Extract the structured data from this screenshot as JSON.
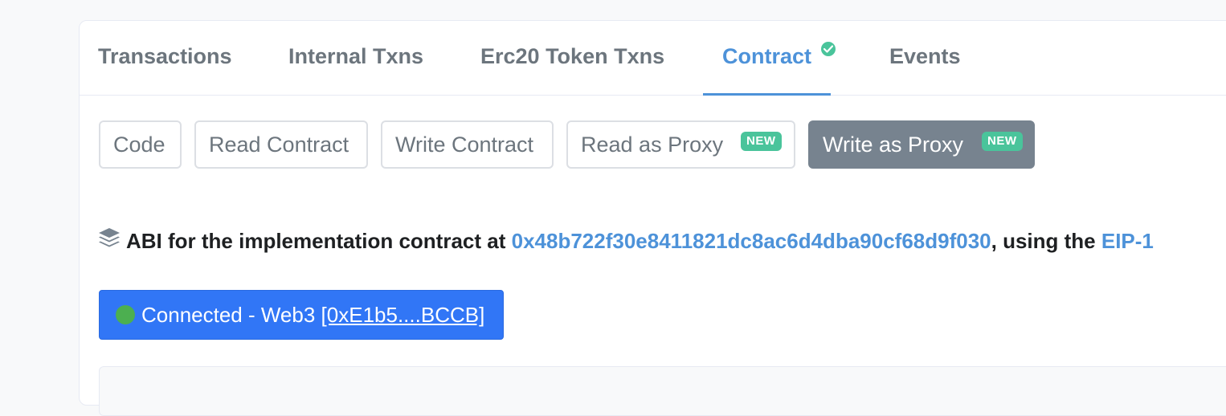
{
  "tabs": [
    {
      "label": "Transactions",
      "active": false
    },
    {
      "label": "Internal Txns",
      "active": false
    },
    {
      "label": "Erc20 Token Txns",
      "active": false
    },
    {
      "label": "Contract",
      "active": true,
      "icon": "check-circle-icon"
    },
    {
      "label": "Events",
      "active": false
    }
  ],
  "subtabs": [
    {
      "label": "Code"
    },
    {
      "label": "Read Contract"
    },
    {
      "label": "Write Contract"
    },
    {
      "label": "Read as Proxy",
      "badge": "NEW"
    },
    {
      "label": "Write as Proxy",
      "badge": "NEW",
      "selected": true
    }
  ],
  "abi": {
    "icon": "layers-icon",
    "prefix": "ABI for the implementation contract at ",
    "address": "0x48b722f30e8411821dc8ac6d4dba90cf68d9f030",
    "middle": ", using the ",
    "standard": "EIP-1"
  },
  "connection": {
    "status_icon": "green-dot-icon",
    "label": "Connected - Web3 ",
    "address": "[0xE1b5....BCCB]"
  },
  "colors": {
    "accent": "#4d92d9",
    "badge": "#4ac49b",
    "selected_subtab": "#77838f",
    "connect_button": "#3176f6",
    "connected_dot": "#4caf50"
  }
}
